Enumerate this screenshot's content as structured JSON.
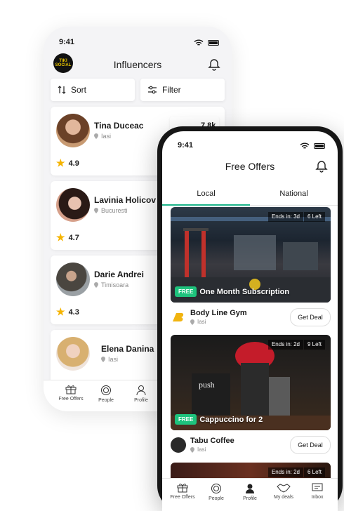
{
  "back_phone": {
    "status_time": "9:41",
    "title": "Influencers",
    "logo_text": "TIKI SOCIAL",
    "sort_label": "Sort",
    "filter_label": "Filter",
    "influencers": [
      {
        "name": "Tina Duceac",
        "location": "Iasi",
        "rating": "4.9",
        "followers": "7.8k"
      },
      {
        "name": "Lavinia Holicov",
        "location": "Bucuresti",
        "rating": "4.7"
      },
      {
        "name": "Darie Andrei",
        "location": "Timisoara",
        "rating": "4.3"
      },
      {
        "name": "Elena Danina",
        "location": "Iasi"
      }
    ],
    "tabbar": [
      "Free Offers",
      "People",
      "Profile"
    ]
  },
  "front_phone": {
    "status_time": "9:41",
    "title": "Free Offers",
    "tabs": [
      "Local",
      "National"
    ],
    "offers": [
      {
        "ends": "Ends in: 3d",
        "left": "6 Left",
        "badge": "FREE",
        "title": "One Month Subscription",
        "merchant": "Body Line Gym",
        "location": "Iasi",
        "button": "Get Deal"
      },
      {
        "ends": "Ends in: 2d",
        "left": "9 Left",
        "badge": "FREE",
        "title": "Cappuccino for 2",
        "merchant": "Tabu Coffee",
        "location": "Iasi",
        "button": "Get Deal"
      },
      {
        "ends": "Ends in: 2d",
        "left": "6 Left"
      }
    ],
    "tabbar": [
      "Free Offers",
      "People",
      "Profile",
      "My deals",
      "Inbox"
    ]
  },
  "colors": {
    "accent": "#1db58a",
    "free_badge": "#1ec37d",
    "star": "#f5b400"
  }
}
